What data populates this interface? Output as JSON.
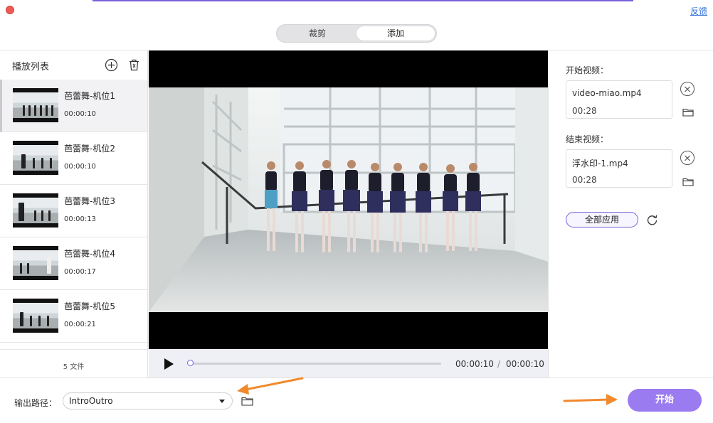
{
  "header": {
    "feedback": "反馈"
  },
  "tabs": [
    {
      "label": "裁剪"
    },
    {
      "label": "添加"
    }
  ],
  "playlist": {
    "title": "播放列表",
    "items": [
      {
        "name": "芭蕾舞-机位1",
        "duration": "00:00:10"
      },
      {
        "name": "芭蕾舞-机位2",
        "duration": "00:00:10"
      },
      {
        "name": "芭蕾舞-机位3",
        "duration": "00:00:13"
      },
      {
        "name": "芭蕾舞-机位4",
        "duration": "00:00:17"
      },
      {
        "name": "芭蕾舞-机位5",
        "duration": "00:00:21"
      }
    ],
    "file_count": "5 文件"
  },
  "player": {
    "current_time": "00:00:10",
    "separator": "/",
    "total_time": "00:00:10"
  },
  "right_panel": {
    "start_label": "开始视频：",
    "start_file": "video-miao.mp4",
    "start_time": "00:28",
    "end_label": "结束视频：",
    "end_file": "浮水印-1.mp4",
    "end_time": "00:28",
    "apply_all": "全部应用"
  },
  "bottom": {
    "output_label": "输出路径：",
    "output_value": "IntroOutro",
    "start_button": "开始"
  },
  "colors": {
    "accent": "#9b7cf0",
    "annotation_arrow": "#f08a2c",
    "close": "#ee5a52"
  }
}
